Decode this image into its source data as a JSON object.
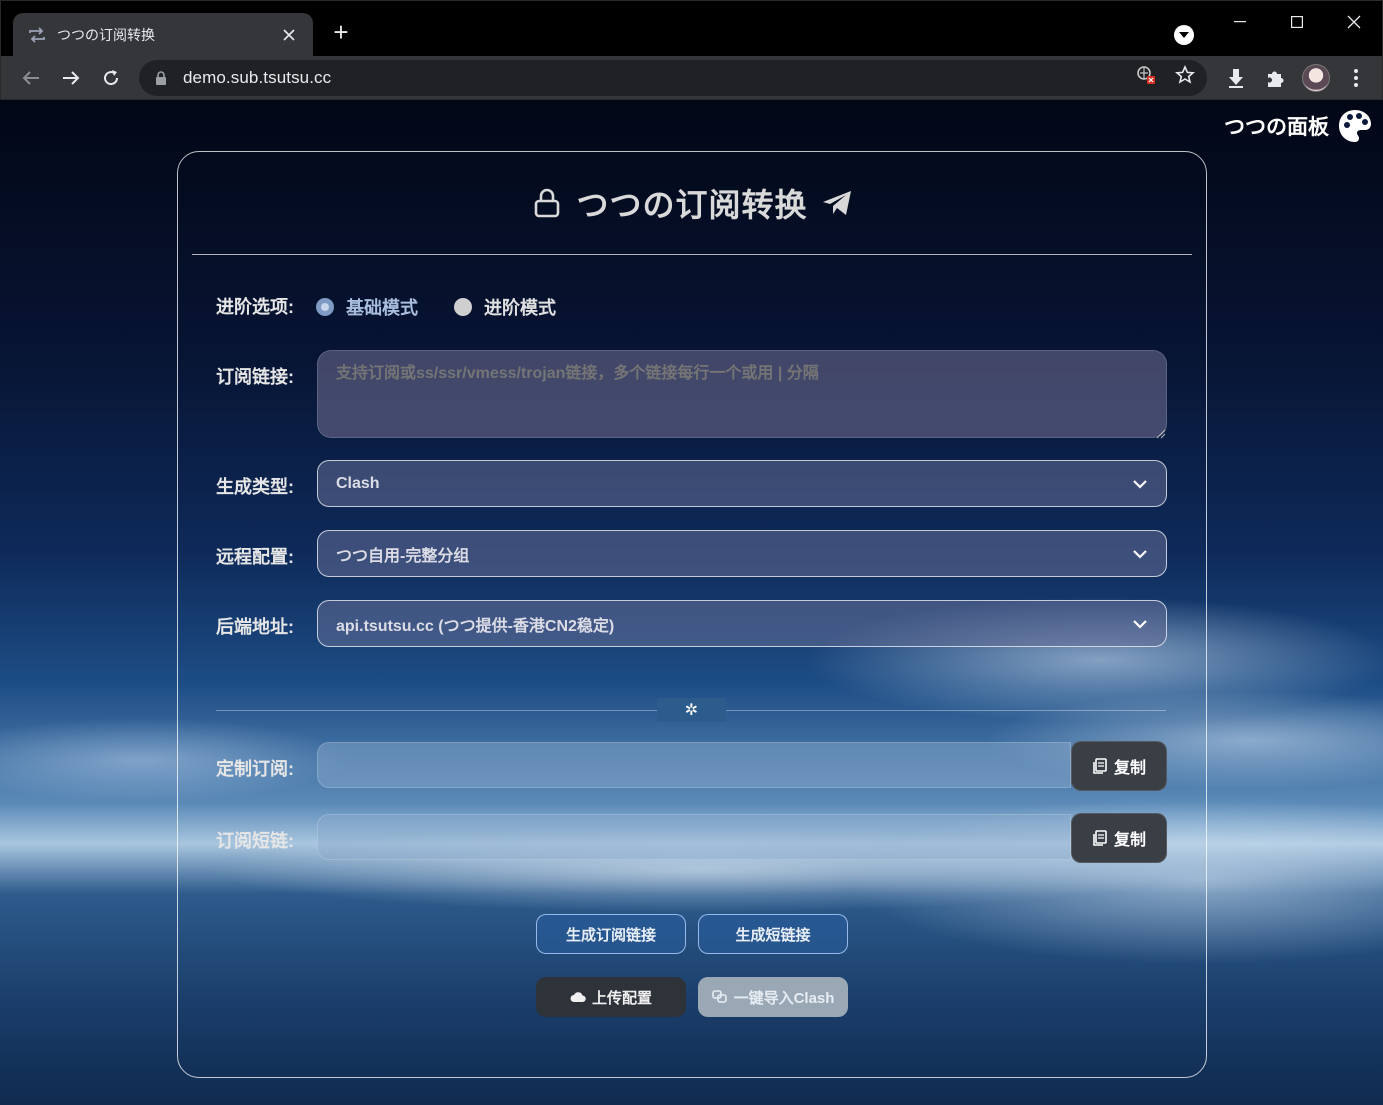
{
  "browser": {
    "tab_title": "つつの订阅转换",
    "new_tab_glyph": "+",
    "url": "demo.sub.tsutsu.cc"
  },
  "page": {
    "brand": "つつの面板",
    "title": "つつの订阅转换",
    "options": {
      "label": "进阶选项:",
      "basic": "基础模式",
      "advanced": "进阶模式",
      "selected": "basic"
    },
    "subscription": {
      "label": "订阅链接:",
      "value": "",
      "placeholder": "支持订阅或ss/ssr/vmess/trojan链接，多个链接每行一个或用 | 分隔"
    },
    "target": {
      "label": "生成类型:",
      "value": "Clash"
    },
    "remote_config": {
      "label": "远程配置:",
      "value": "つつ自用-完整分组"
    },
    "backend": {
      "label": "后端地址:",
      "value": "api.tsutsu.cc (つつ提供-香港CN2稳定)"
    },
    "divider_glyph": "✲",
    "custom_sub": {
      "label": "定制订阅:",
      "value": "",
      "copy": "复制"
    },
    "short_link": {
      "label": "订阅短链:",
      "value": "",
      "copy": "复制"
    },
    "buttons": {
      "generate_sub": "生成订阅链接",
      "generate_short": "生成短链接",
      "upload_config": "上传配置",
      "import_clash": "一键导入Clash"
    }
  },
  "colors": {
    "accent_blue": "#2c5c8c",
    "dark_button": "#2e3339",
    "gray_button": "#9aa8b6"
  }
}
